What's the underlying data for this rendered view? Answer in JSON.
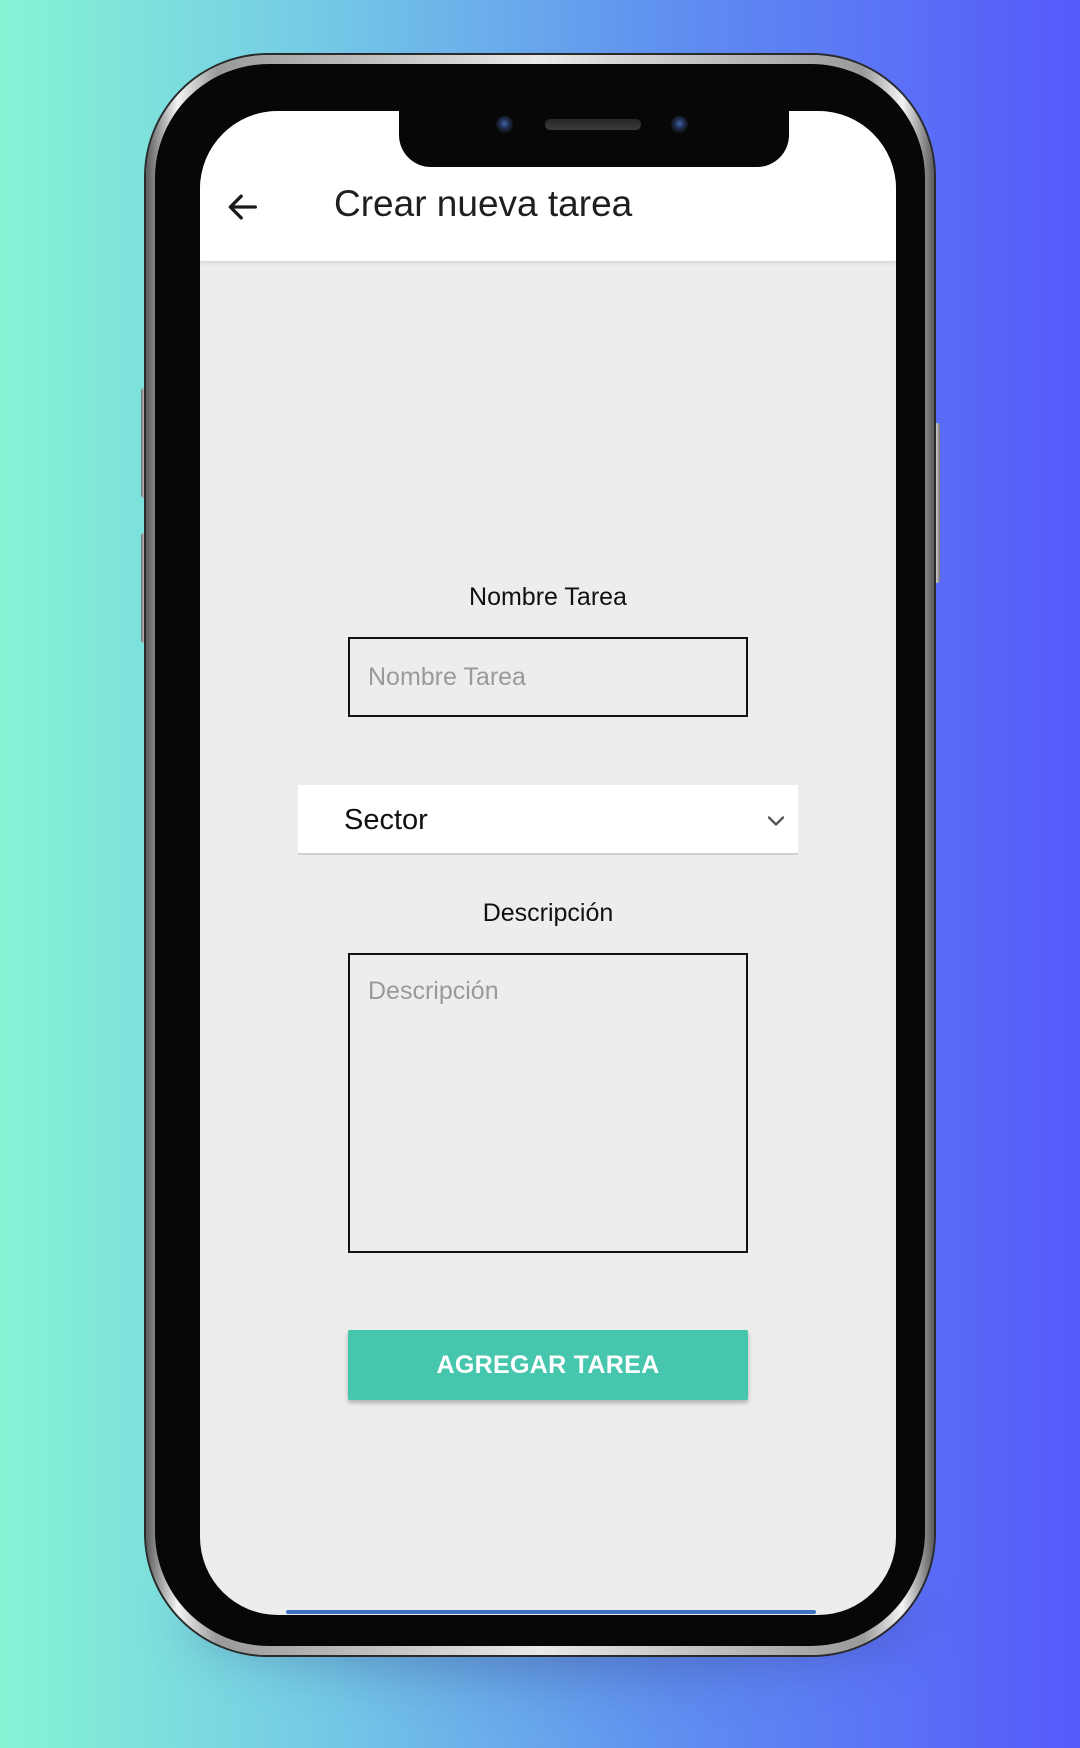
{
  "app_bar": {
    "title": "Crear nueva tarea",
    "back_icon": "arrow-left-icon"
  },
  "form": {
    "name_label": "Nombre Tarea",
    "name_placeholder": "Nombre Tarea",
    "name_value": "",
    "sector_selected": "Sector",
    "sector_icon": "chevron-down-icon",
    "description_label": "Descripción",
    "description_placeholder": "Descripción",
    "description_value": "",
    "submit_label": "AGREGAR TAREA"
  },
  "colors": {
    "accent": "#45c6ad",
    "screen_background": "#ededed",
    "app_bar_background": "#ffffff",
    "background_gradient_start": "#86f5d4",
    "background_gradient_end": "#5659fb"
  }
}
